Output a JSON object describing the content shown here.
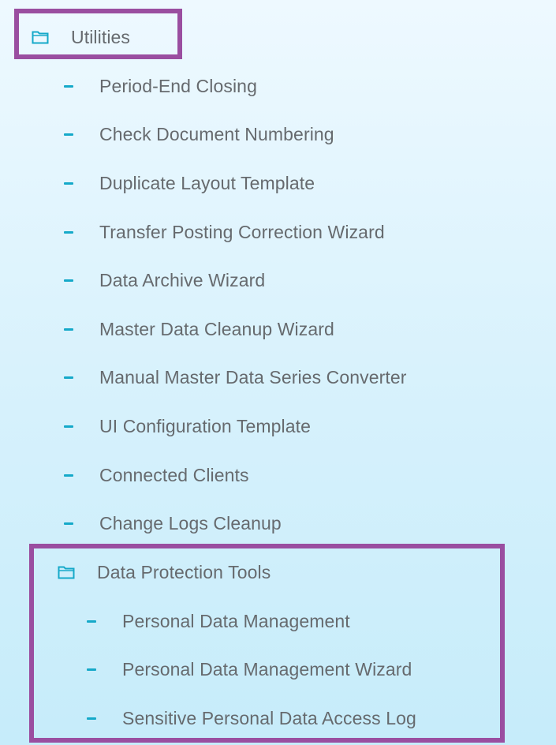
{
  "tree": {
    "root": {
      "icon": "folder-icon",
      "label": "Utilities"
    },
    "items": [
      {
        "icon": "dash-icon",
        "label": "Period-End Closing"
      },
      {
        "icon": "dash-icon",
        "label": "Check Document Numbering"
      },
      {
        "icon": "dash-icon",
        "label": "Duplicate Layout Template"
      },
      {
        "icon": "dash-icon",
        "label": "Transfer Posting Correction Wizard"
      },
      {
        "icon": "dash-icon",
        "label": "Data Archive Wizard"
      },
      {
        "icon": "dash-icon",
        "label": "Master Data Cleanup Wizard"
      },
      {
        "icon": "dash-icon",
        "label": "Manual Master Data Series Converter"
      },
      {
        "icon": "dash-icon",
        "label": "UI Configuration Template"
      },
      {
        "icon": "dash-icon",
        "label": "Connected Clients"
      },
      {
        "icon": "dash-icon",
        "label": "Change Logs Cleanup"
      }
    ],
    "subfolder": {
      "icon": "folder-icon",
      "label": "Data Protection Tools",
      "items": [
        {
          "icon": "dash-icon",
          "label": "Personal Data Management"
        },
        {
          "icon": "dash-icon",
          "label": "Personal Data Management Wizard"
        },
        {
          "icon": "dash-icon",
          "label": "Sensitive Personal Data Access Log"
        }
      ]
    }
  },
  "colors": {
    "accent": "#15a9c9",
    "text": "#666a6e",
    "highlight": "#9a4ea0",
    "background": "#dff4fd"
  }
}
